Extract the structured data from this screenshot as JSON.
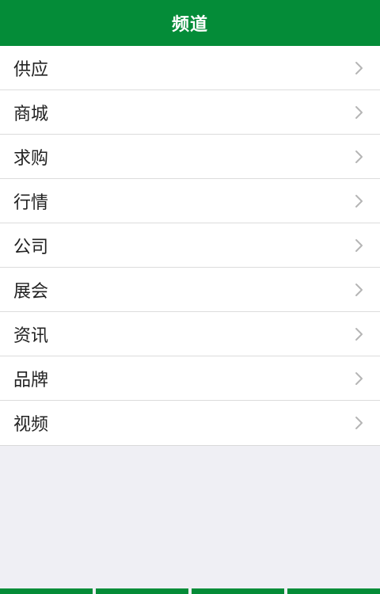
{
  "header": {
    "title": "频道"
  },
  "channels": [
    {
      "label": "供应",
      "icon": "chevron-right-icon"
    },
    {
      "label": "商城",
      "icon": "chevron-right-icon"
    },
    {
      "label": "求购",
      "icon": "chevron-right-icon"
    },
    {
      "label": "行情",
      "icon": "chevron-right-icon"
    },
    {
      "label": "公司",
      "icon": "chevron-right-icon"
    },
    {
      "label": "展会",
      "icon": "chevron-right-icon"
    },
    {
      "label": "资讯",
      "icon": "chevron-right-icon"
    },
    {
      "label": "品牌",
      "icon": "chevron-right-icon"
    },
    {
      "label": "视频",
      "icon": "chevron-right-icon"
    }
  ],
  "colors": {
    "brand": "#048c38",
    "background": "#efeff4",
    "text": "#222222",
    "chevron": "#b5b5b5"
  }
}
